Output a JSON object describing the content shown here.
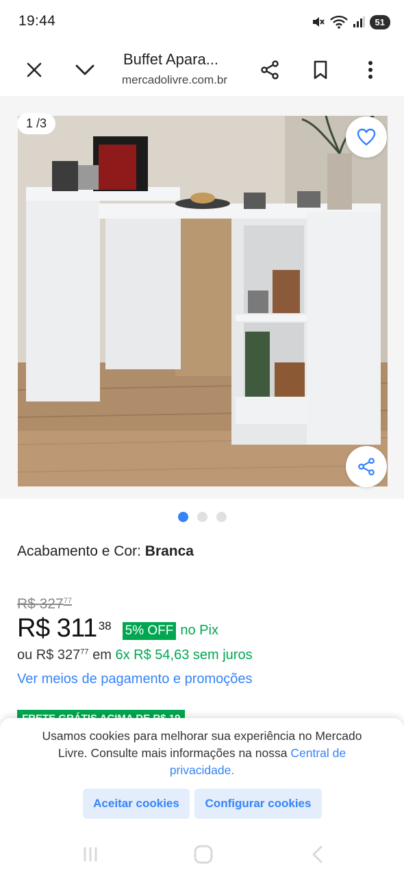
{
  "status": {
    "time": "19:44",
    "battery": "51"
  },
  "browser": {
    "page_title": "Buffet Apara...",
    "domain": "mercadolivre.com.br"
  },
  "gallery": {
    "counter": "1 /3",
    "total_images": 3,
    "active_index": 0
  },
  "variant": {
    "label": "Acabamento e Cor:",
    "value": "Branca"
  },
  "price": {
    "old_main": "R$ 327",
    "old_cents": "77",
    "current_main": "R$ 311",
    "current_cents": "38",
    "discount": "5% OFF",
    "discount_method": "no Pix",
    "installments_prefix": "ou R$ 327",
    "installments_cents": "77",
    "installments_em": "em",
    "installments_detail": "6x R$ 54,63 sem juros",
    "payment_link": "Ver meios de pagamento e promoções"
  },
  "shipping_badge": "FRETE GRÁTIS ACIMA DE R$ 19",
  "cookie": {
    "text": "Usamos cookies para melhorar sua experiência no Mercado Livre. Consulte mais informações na nossa",
    "link": "Central de privacidade.",
    "accept": "Aceitar cookies",
    "configure": "Configurar cookies"
  },
  "colors": {
    "accent_blue": "#3483fa",
    "green": "#00a650",
    "button_bg": "#e3edfb"
  }
}
